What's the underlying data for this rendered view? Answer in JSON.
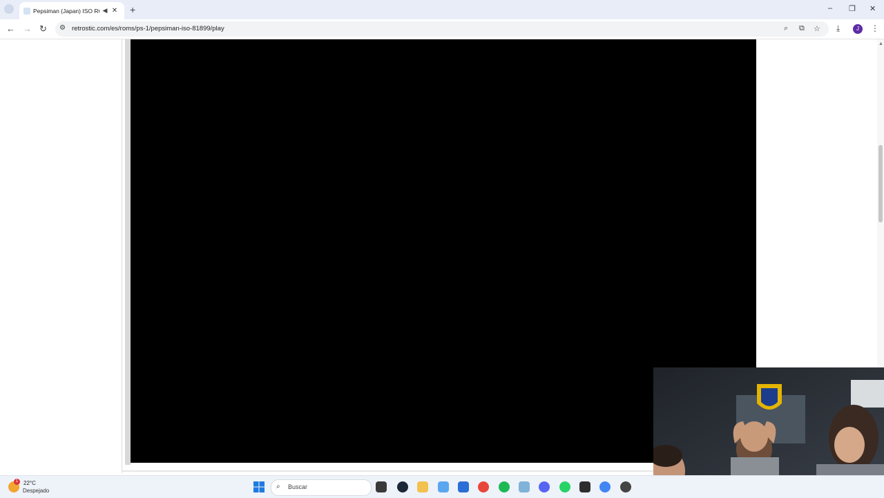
{
  "browser": {
    "tab_title": "Pepsiman (Japan) ISO ROM",
    "new_tab": "+",
    "url": "retrostic.com/es/roms/ps-1/pepsiman-iso-81899/play",
    "profile_initial": "J"
  },
  "icons": {
    "back": "arrow-left-icon",
    "forward": "arrow-right-icon",
    "reload": "reload-icon",
    "site_info": "tune-icon",
    "zoom": "zoom-icon",
    "install": "install-app-icon",
    "bookmark": "star-icon",
    "downloads": "download-icon",
    "menu": "kebab-menu-icon",
    "audio": "speaker-icon",
    "close": "close-icon"
  },
  "glyphs": {
    "back": "←",
    "forward": "→",
    "reload": "↻",
    "site_info": "⚙",
    "zoom": "⌕",
    "install": "⧉",
    "star": "☆",
    "download": "⤓",
    "menu": "⋮",
    "close": "✕",
    "audio": "◀",
    "minimize": "–",
    "restore": "❐",
    "win_close": "✕",
    "scroll_up": "▲",
    "search": "⌕"
  },
  "taskbar": {
    "temperature": "22°C",
    "weather": "Despejado",
    "weather_badge": "1",
    "search_placeholder": "Buscar",
    "apps": [
      "file-explorer",
      "steam",
      "files",
      "copilot",
      "store",
      "chrome",
      "spotify",
      "photos",
      "discord",
      "whatsapp",
      "terminal",
      "chrome-profile",
      "media-player"
    ]
  },
  "colors": {
    "accent": "#5e2ca5",
    "game_bg": "#000000",
    "tabbar_bg": "#e8edf7"
  }
}
